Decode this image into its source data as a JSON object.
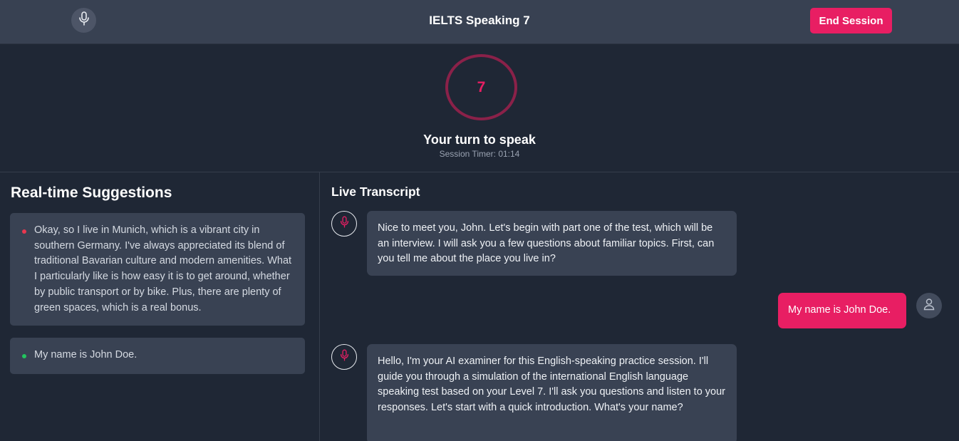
{
  "header": {
    "title": "IELTS Speaking 7",
    "end_session_label": "End Session",
    "mic_icon": "microphone-icon"
  },
  "status": {
    "level": "7",
    "turn_text": "Your turn to speak",
    "timer_text": "Session Timer: 01:14"
  },
  "suggestions": {
    "title": "Real-time Suggestions",
    "items": [
      {
        "text": "Okay, so I live in Munich, which is a vibrant city in southern Germany. I've always appreciated its blend of traditional Bavarian culture and modern amenities. What I particularly like is how easy it is to get around, whether by public transport or by bike. Plus, there are plenty of green spaces, which is a real bonus.",
        "dot_color": "#e8374f"
      },
      {
        "text": "My name is John Doe.",
        "dot_color": "#22c55e"
      }
    ]
  },
  "transcript": {
    "title": "Live Transcript",
    "messages": [
      {
        "role": "examiner",
        "text": "Nice to meet you, John. Let's begin with part one of the test, which will be an interview. I will ask you a few questions about familiar topics. First, can you tell me about the place you live in?"
      },
      {
        "role": "user",
        "text": "My name is John Doe."
      },
      {
        "role": "examiner",
        "text": "Hello, I'm your AI examiner for this English-speaking practice session. I'll guide you through a simulation of the international English language speaking test based on your Level 7. I'll ask you questions and listen to your responses. Let's start with a quick introduction. What's your name?"
      }
    ]
  },
  "colors": {
    "accent": "#e81e63",
    "background": "#1f2735",
    "panel": "#394253",
    "header": "#384152"
  }
}
